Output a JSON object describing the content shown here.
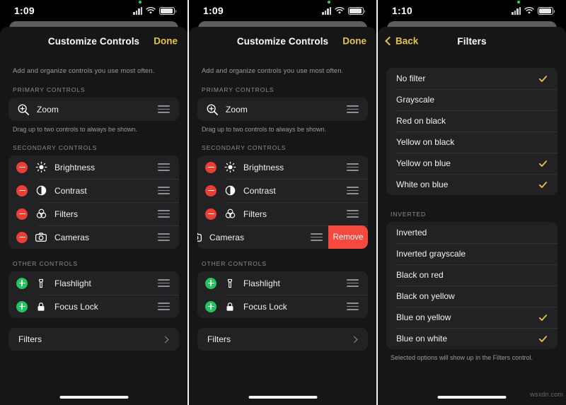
{
  "colors": {
    "accent_yellow": "#e5c547",
    "remove_red": "#f5483f",
    "minus_red": "#ea3f35",
    "plus_green": "#22c55e",
    "sheet_bg": "#161617",
    "group_bg": "#222224"
  },
  "panel1": {
    "status": {
      "time": "1:09",
      "cellular": "signal-bars-icon",
      "wifi": "wifi-icon",
      "battery": "battery-icon"
    },
    "nav": {
      "title": "Customize Controls",
      "done_label": "Done"
    },
    "subtitle": "Add and organize controls you use most often.",
    "sections": [
      {
        "header": "PRIMARY CONTROLS",
        "footnote": "Drag up to two controls to always be shown.",
        "rows": [
          {
            "label": "Zoom",
            "icon": "zoom-in-icon",
            "badge": "none",
            "handle": true
          }
        ]
      },
      {
        "header": "SECONDARY CONTROLS",
        "footnote": "",
        "rows": [
          {
            "label": "Brightness",
            "icon": "brightness-icon",
            "badge": "minus",
            "handle": true
          },
          {
            "label": "Contrast",
            "icon": "contrast-icon",
            "badge": "minus",
            "handle": true
          },
          {
            "label": "Filters",
            "icon": "filters-icon",
            "badge": "minus",
            "handle": true
          },
          {
            "label": "Cameras",
            "icon": "camera-icon",
            "badge": "minus",
            "handle": true
          }
        ]
      },
      {
        "header": "OTHER CONTROLS",
        "footnote": "",
        "rows": [
          {
            "label": "Flashlight",
            "icon": "flashlight-icon",
            "badge": "plus",
            "handle": true
          },
          {
            "label": "Focus Lock",
            "icon": "lock-icon",
            "badge": "plus",
            "handle": true
          }
        ]
      }
    ],
    "filters_link": {
      "label": "Filters",
      "chevron": "chevron-right-icon"
    }
  },
  "panel2": {
    "status": {
      "time": "1:09",
      "cellular": "signal-bars-icon",
      "wifi": "wifi-icon",
      "battery": "battery-icon"
    },
    "nav": {
      "title": "Customize Controls",
      "done_label": "Done"
    },
    "subtitle": "Add and organize controls you use most often.",
    "sections": [
      {
        "header": "PRIMARY CONTROLS",
        "footnote": "Drag up to two controls to always be shown.",
        "rows": [
          {
            "label": "Zoom",
            "icon": "zoom-in-icon",
            "badge": "none",
            "handle": true
          }
        ]
      },
      {
        "header": "SECONDARY CONTROLS",
        "footnote": "",
        "rows": [
          {
            "label": "Brightness",
            "icon": "brightness-icon",
            "badge": "minus",
            "handle": true
          },
          {
            "label": "Contrast",
            "icon": "contrast-icon",
            "badge": "minus",
            "handle": true
          },
          {
            "label": "Filters",
            "icon": "filters-icon",
            "badge": "minus",
            "handle": true
          },
          {
            "label": "Cameras",
            "icon": "camera-icon",
            "badge": "none",
            "handle": true,
            "swiped": true,
            "action_label": "Remove"
          }
        ]
      },
      {
        "header": "OTHER CONTROLS",
        "footnote": "",
        "rows": [
          {
            "label": "Flashlight",
            "icon": "flashlight-icon",
            "badge": "plus",
            "handle": true
          },
          {
            "label": "Focus Lock",
            "icon": "lock-icon",
            "badge": "plus",
            "handle": true
          }
        ]
      }
    ],
    "filters_link": {
      "label": "Filters",
      "chevron": "chevron-right-icon"
    }
  },
  "panel3": {
    "status": {
      "time": "1:10",
      "cellular": "signal-bars-icon",
      "wifi": "wifi-icon",
      "battery": "battery-icon"
    },
    "nav": {
      "title": "Filters",
      "back_label": "Back"
    },
    "groups": [
      {
        "header": "",
        "options": [
          {
            "label": "No filter",
            "checked": true
          },
          {
            "label": "Grayscale",
            "checked": false
          },
          {
            "label": "Red on black",
            "checked": false
          },
          {
            "label": "Yellow on black",
            "checked": false
          },
          {
            "label": "Yellow on blue",
            "checked": true
          },
          {
            "label": "White on blue",
            "checked": true
          }
        ]
      },
      {
        "header": "INVERTED",
        "options": [
          {
            "label": "Inverted",
            "checked": false
          },
          {
            "label": "Inverted grayscale",
            "checked": false
          },
          {
            "label": "Black on red",
            "checked": false
          },
          {
            "label": "Black on yellow",
            "checked": false
          },
          {
            "label": "Blue on yellow",
            "checked": true
          },
          {
            "label": "Blue on white",
            "checked": true
          }
        ]
      }
    ],
    "footnote": "Selected options will show up in the Filters control."
  },
  "watermark": "wsxdn.com"
}
